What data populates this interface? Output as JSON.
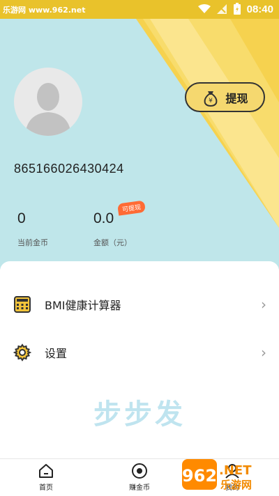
{
  "statusbar": {
    "watermark_text": "乐游网 www.962.net",
    "time": "08:40"
  },
  "profile": {
    "user_id": "865166026430424",
    "withdraw_label": "提现",
    "coins": {
      "value": "0",
      "label": "当前金币"
    },
    "balance": {
      "value": "0.0",
      "label": "金额（元）",
      "badge": "可提现"
    }
  },
  "menu": [
    {
      "label": "BMI健康计算器",
      "icon": "calculator-icon"
    },
    {
      "label": "设置",
      "icon": "gear-icon"
    }
  ],
  "watermark": "步步发",
  "bottom_nav": [
    {
      "label": "首页",
      "icon": "home-icon"
    },
    {
      "label": "赚金币",
      "icon": "target-icon"
    },
    {
      "label": "我的",
      "icon": "user-icon"
    }
  ],
  "site_logo": {
    "text": "962",
    "suffix": ".NET",
    "tagline": "乐游网"
  },
  "colors": {
    "accent": "#f5c842",
    "hero_bg": "#bfe6ea",
    "badge": "#ff6b35"
  }
}
